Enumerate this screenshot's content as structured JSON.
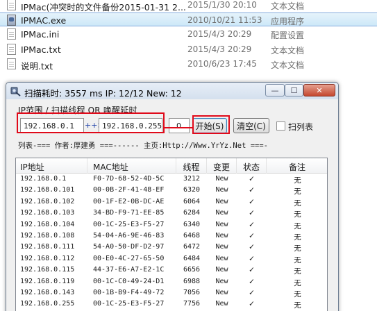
{
  "explorer": {
    "files": [
      {
        "name": "IPMac(冲突时的文件备份2015-01-31 2...",
        "date": "2015/1/30 20:10",
        "type": "文本文档",
        "icon": "text-file-icon",
        "selected": false
      },
      {
        "name": "IPMAC.exe",
        "date": "2010/10/21 11:53",
        "type": "应用程序",
        "icon": "exe-file-icon",
        "selected": true
      },
      {
        "name": "IPMac.ini",
        "date": "2015/4/3 20:29",
        "type": "配置设置",
        "icon": "ini-file-icon",
        "selected": false
      },
      {
        "name": "IPMac.txt",
        "date": "2015/4/3 20:29",
        "type": "文本文档",
        "icon": "text-file-icon",
        "selected": false
      },
      {
        "name": "说明.txt",
        "date": "2010/6/23 17:45",
        "type": "文本文档",
        "icon": "text-file-icon",
        "selected": false
      }
    ]
  },
  "window": {
    "title": "扫描耗时: 3557 ms   IP: 12/12   New: 12",
    "minimize": "—",
    "maximize": "☐",
    "close": "✕"
  },
  "scan": {
    "range_label": "IP范围 / 扫描线程  OR  唤醒延时",
    "ip_start": "192.168.0.1",
    "arrow": "++>",
    "ip_end": "192.168.0.255",
    "delay": "0",
    "start_button": "开始(S)",
    "clear_button": "清空(C)",
    "scan_columns_label": "扫列表",
    "scan_columns_checked": false
  },
  "banner": "列表-=== 作者:厚建勇 ===------ 主页:Http://Www.YrYz.Net ===-",
  "table": {
    "headers": [
      "IP地址",
      "MAC地址",
      "线程",
      "变更",
      "状态",
      "备注"
    ],
    "rows": [
      {
        "ip": "192.168.0.1",
        "mac": "F0-7D-68-52-4D-5C",
        "thread": "3212",
        "change": "New",
        "status": "✓",
        "note": "无"
      },
      {
        "ip": "192.168.0.101",
        "mac": "00-0B-2F-41-48-EF",
        "thread": "6320",
        "change": "New",
        "status": "✓",
        "note": "无"
      },
      {
        "ip": "192.168.0.102",
        "mac": "00-1F-E2-0B-DC-AE",
        "thread": "6064",
        "change": "New",
        "status": "✓",
        "note": "无"
      },
      {
        "ip": "192.168.0.103",
        "mac": "34-BD-F9-71-EE-85",
        "thread": "6284",
        "change": "New",
        "status": "✓",
        "note": "无"
      },
      {
        "ip": "192.168.0.104",
        "mac": "00-1C-25-E3-F5-27",
        "thread": "6340",
        "change": "New",
        "status": "✓",
        "note": "无"
      },
      {
        "ip": "192.168.0.108",
        "mac": "54-04-A6-9E-46-83",
        "thread": "6468",
        "change": "New",
        "status": "✓",
        "note": "无"
      },
      {
        "ip": "192.168.0.111",
        "mac": "54-A0-50-DF-D2-97",
        "thread": "6472",
        "change": "New",
        "status": "✓",
        "note": "无"
      },
      {
        "ip": "192.168.0.112",
        "mac": "00-E0-4C-27-65-50",
        "thread": "6484",
        "change": "New",
        "status": "✓",
        "note": "无"
      },
      {
        "ip": "192.168.0.115",
        "mac": "44-37-E6-A7-E2-1C",
        "thread": "6656",
        "change": "New",
        "status": "✓",
        "note": "无"
      },
      {
        "ip": "192.168.0.119",
        "mac": "00-1C-C0-49-24-D1",
        "thread": "6988",
        "change": "New",
        "status": "✓",
        "note": "无"
      },
      {
        "ip": "192.168.0.143",
        "mac": "00-1B-B9-F4-49-72",
        "thread": "7056",
        "change": "New",
        "status": "✓",
        "note": "无"
      },
      {
        "ip": "192.168.0.255",
        "mac": "00-1C-25-E3-F5-27",
        "thread": "7756",
        "change": "New",
        "status": "✓",
        "note": "无"
      }
    ]
  }
}
